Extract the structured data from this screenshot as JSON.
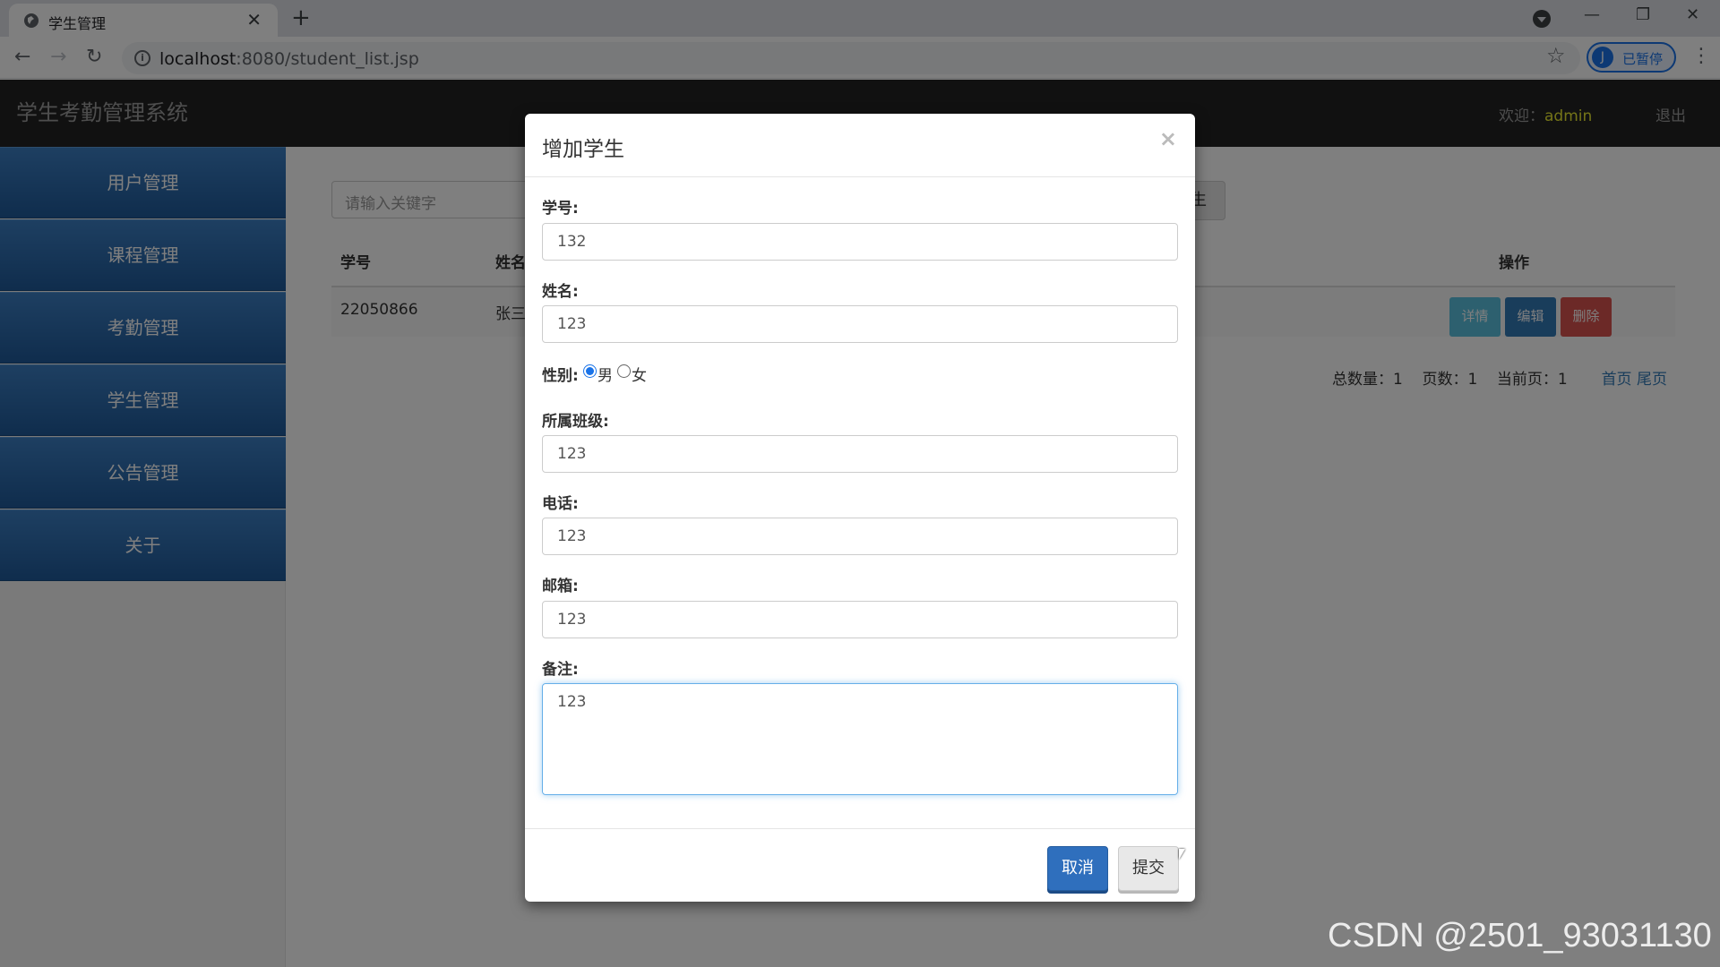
{
  "browser": {
    "tab_title": "学生管理",
    "url_host": "localhost",
    "url_rest": ":8080/student_list.jsp",
    "profile_initial": "J",
    "profile_status": "已暂停"
  },
  "navbar": {
    "brand": "学生考勤管理系统",
    "welcome_label": "欢迎：",
    "username": "admin",
    "logout": "退出"
  },
  "sidebar": {
    "items": [
      {
        "label": "用户管理"
      },
      {
        "label": "课程管理"
      },
      {
        "label": "考勤管理"
      },
      {
        "label": "学生管理"
      },
      {
        "label": "公告管理"
      },
      {
        "label": "关于"
      }
    ]
  },
  "content": {
    "search_placeholder": "请输入关键字",
    "add_button_partial": "生",
    "table": {
      "headers": {
        "id": "学号",
        "name": "姓名",
        "ops": "操作"
      },
      "rows": [
        {
          "id": "22050866",
          "name": "张三"
        }
      ],
      "ops": {
        "detail": "详情",
        "edit": "编辑",
        "delete": "删除"
      }
    },
    "pager": {
      "total_label": "总数量：",
      "total": "1",
      "pages_label": "页数：",
      "pages": "1",
      "current_label": "当前页：",
      "current": "1",
      "first": "首页",
      "last": "尾页"
    }
  },
  "modal": {
    "title": "增加学生",
    "close": "×",
    "fields": {
      "student_id": {
        "label": "学号:",
        "value": "132"
      },
      "name": {
        "label": "姓名:",
        "value": "123"
      },
      "gender": {
        "label": "性别:",
        "options": [
          "男",
          "女"
        ],
        "selected": "男"
      },
      "class": {
        "label": "所属班级:",
        "value": "123"
      },
      "phone": {
        "label": "电话:",
        "value": "123"
      },
      "email": {
        "label": "邮箱:",
        "value": "123"
      },
      "note": {
        "label": "备注:",
        "value": "123"
      }
    },
    "cancel": "取消",
    "submit": "提交"
  },
  "watermark": "CSDN @2501_93031130",
  "colors": {
    "primary": "#337ab7",
    "navbar": "#222222",
    "sidebar_item": "#2a6aad",
    "username": "#e8e830"
  }
}
